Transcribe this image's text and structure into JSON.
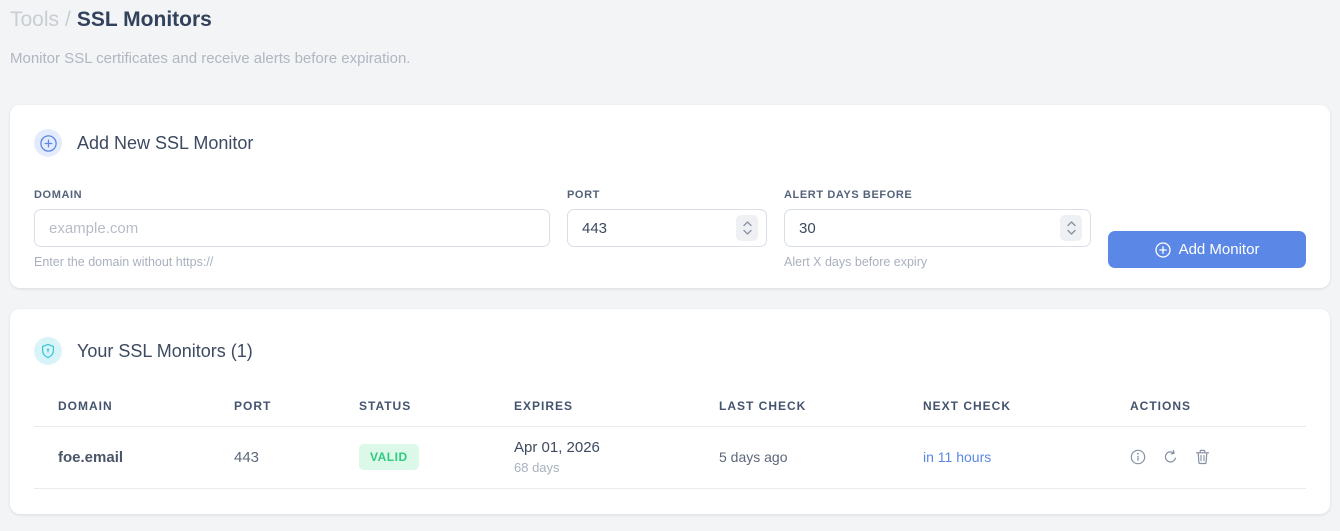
{
  "page": {
    "breadcrumb": {
      "parent": "Tools",
      "separator": "/",
      "current": "SSL Monitors"
    },
    "subtitle": "Monitor SSL certificates and receive alerts before expiration."
  },
  "add_monitor": {
    "title": "Add New SSL Monitor",
    "fields": {
      "domain": {
        "label": "DOMAIN",
        "placeholder": "example.com",
        "value": "",
        "hint": "Enter the domain without https://"
      },
      "port": {
        "label": "PORT",
        "value": "443"
      },
      "alert_days": {
        "label": "ALERT DAYS BEFORE",
        "value": "30",
        "hint": "Alert X days before expiry"
      }
    },
    "submit_label": "Add Monitor"
  },
  "monitors": {
    "title": "Your SSL Monitors (1)",
    "count": "1",
    "table": {
      "headers": [
        "DOMAIN",
        "PORT",
        "STATUS",
        "EXPIRES",
        "LAST CHECK",
        "NEXT CHECK",
        "ACTIONS"
      ],
      "rows": [
        {
          "domain": "foe.email",
          "port": "443",
          "status": "VALID",
          "expires_date": "Apr 01, 2026",
          "expires_days": "68 days",
          "last_check": "5 days ago",
          "next_check": "in 11 hours"
        }
      ]
    }
  },
  "icons": {
    "add_section": "plus-circle",
    "monitors_section": "shield-lock",
    "submit": "plus-circle",
    "row_actions": [
      "info-circle",
      "refresh",
      "trash"
    ]
  },
  "colors": {
    "accent_blue": "#5b87e6",
    "accent_cyan": "#35c3d7",
    "success_text": "#2fcb82",
    "success_bg": "#dcf8e9",
    "page_bg": "#f2f4f5",
    "card_bg": "#ffffff"
  }
}
